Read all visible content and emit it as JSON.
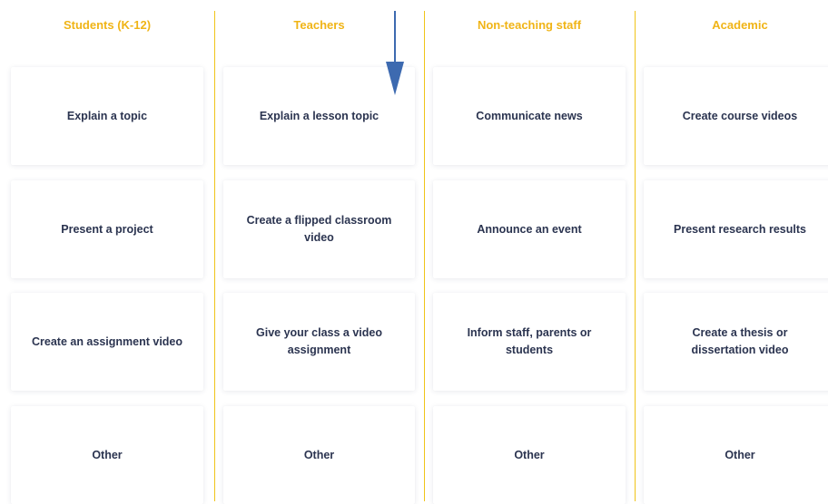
{
  "columns": [
    {
      "header": "Students (K-12)",
      "cards": [
        "Explain a topic",
        "Present a project",
        "Create an assignment video",
        "Other"
      ]
    },
    {
      "header": "Teachers",
      "cards": [
        "Explain a lesson topic",
        "Create a flipped classroom video",
        "Give your class a video assignment",
        "Other"
      ]
    },
    {
      "header": "Non-teaching staff",
      "cards": [
        "Communicate news",
        "Announce an event",
        "Inform staff, parents or students",
        "Other"
      ]
    },
    {
      "header": "Academic",
      "cards": [
        "Create course videos",
        "Present research results",
        "Create a thesis or dissertation video",
        "Other"
      ]
    }
  ],
  "colors": {
    "header_yellow": "#f0b416",
    "divider_yellow": "#f0c419",
    "card_text": "#2b3450",
    "arrow_blue": "#3d6ab0"
  },
  "icons": {
    "arrow": "down-arrow-icon"
  }
}
